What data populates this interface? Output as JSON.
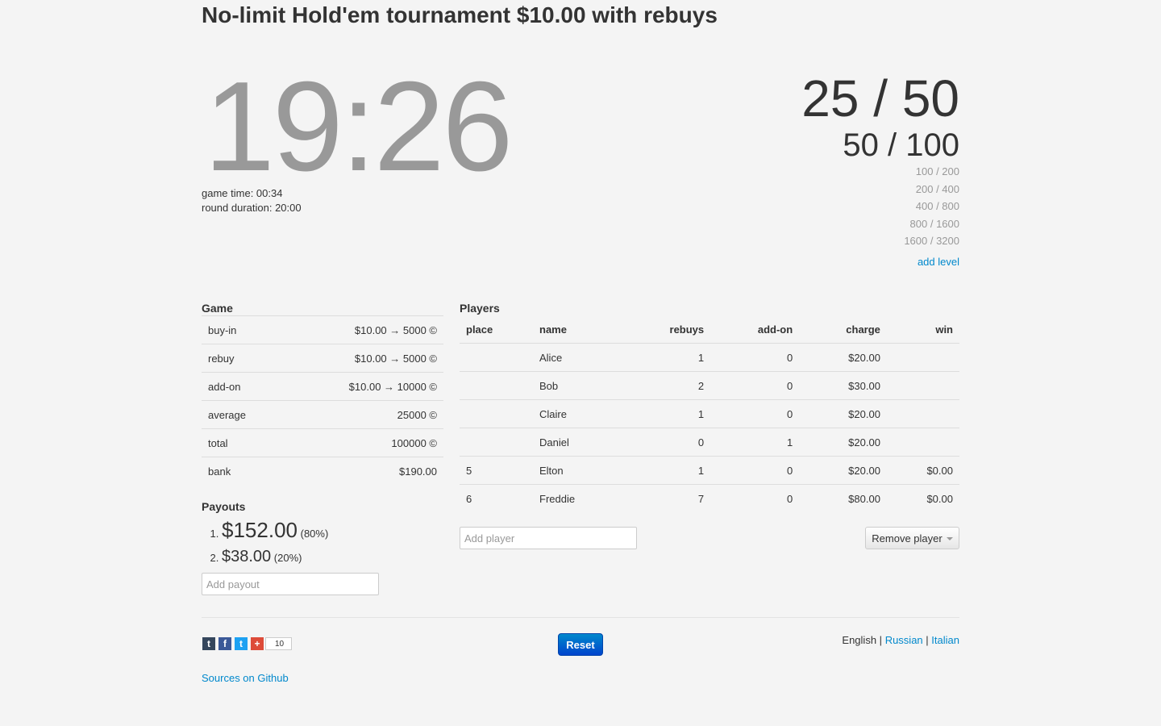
{
  "title": "No-limit Hold'em tournament $10.00 with rebuys",
  "timer": "19:26",
  "game_time": "game time: 00:34",
  "round_duration": "round duration: 20:00",
  "blinds": {
    "current": "25 / 50",
    "next": "50 / 100",
    "future": [
      "100 / 200",
      "200 / 400",
      "400 / 800",
      "800 / 1600",
      "1600 / 3200"
    ],
    "add_level": "add level"
  },
  "game": {
    "heading": "Game",
    "rows": [
      {
        "label": "buy-in",
        "value": "$10.00 → 5000 ©"
      },
      {
        "label": "rebuy",
        "value": "$10.00 → 5000 ©"
      },
      {
        "label": "add-on",
        "value": "$10.00 → 10000 ©"
      },
      {
        "label": "average",
        "value": "25000 ©"
      },
      {
        "label": "total",
        "value": "100000 ©"
      },
      {
        "label": "bank",
        "value": "$190.00"
      }
    ]
  },
  "payouts": {
    "heading": "Payouts",
    "items": [
      {
        "amount": "$152.00",
        "percent": "(80%)"
      },
      {
        "amount": "$38.00",
        "percent": "(20%)"
      }
    ],
    "placeholder": "Add payout"
  },
  "players": {
    "heading": "Players",
    "columns": [
      "place",
      "name",
      "rebuys",
      "add-on",
      "charge",
      "win"
    ],
    "rows": [
      {
        "place": "",
        "name": "Alice",
        "rebuys": "1",
        "addon": "0",
        "charge": "$20.00",
        "win": ""
      },
      {
        "place": "",
        "name": "Bob",
        "rebuys": "2",
        "addon": "0",
        "charge": "$30.00",
        "win": ""
      },
      {
        "place": "",
        "name": "Claire",
        "rebuys": "1",
        "addon": "0",
        "charge": "$20.00",
        "win": ""
      },
      {
        "place": "",
        "name": "Daniel",
        "rebuys": "0",
        "addon": "1",
        "charge": "$20.00",
        "win": ""
      },
      {
        "place": "5",
        "name": "Elton",
        "rebuys": "1",
        "addon": "0",
        "charge": "$20.00",
        "win": "$0.00"
      },
      {
        "place": "6",
        "name": "Freddie",
        "rebuys": "7",
        "addon": "0",
        "charge": "$80.00",
        "win": "$0.00"
      }
    ],
    "add_placeholder": "Add player",
    "remove_label": "Remove player"
  },
  "social": {
    "tumblr": "t",
    "facebook": "f",
    "twitter": "t",
    "gplus": "+",
    "count": "10"
  },
  "reset_label": "Reset",
  "languages": {
    "english": "English",
    "sep": "|",
    "russian": "Russian",
    "italian": "Italian"
  },
  "sources_link": "Sources on Github"
}
